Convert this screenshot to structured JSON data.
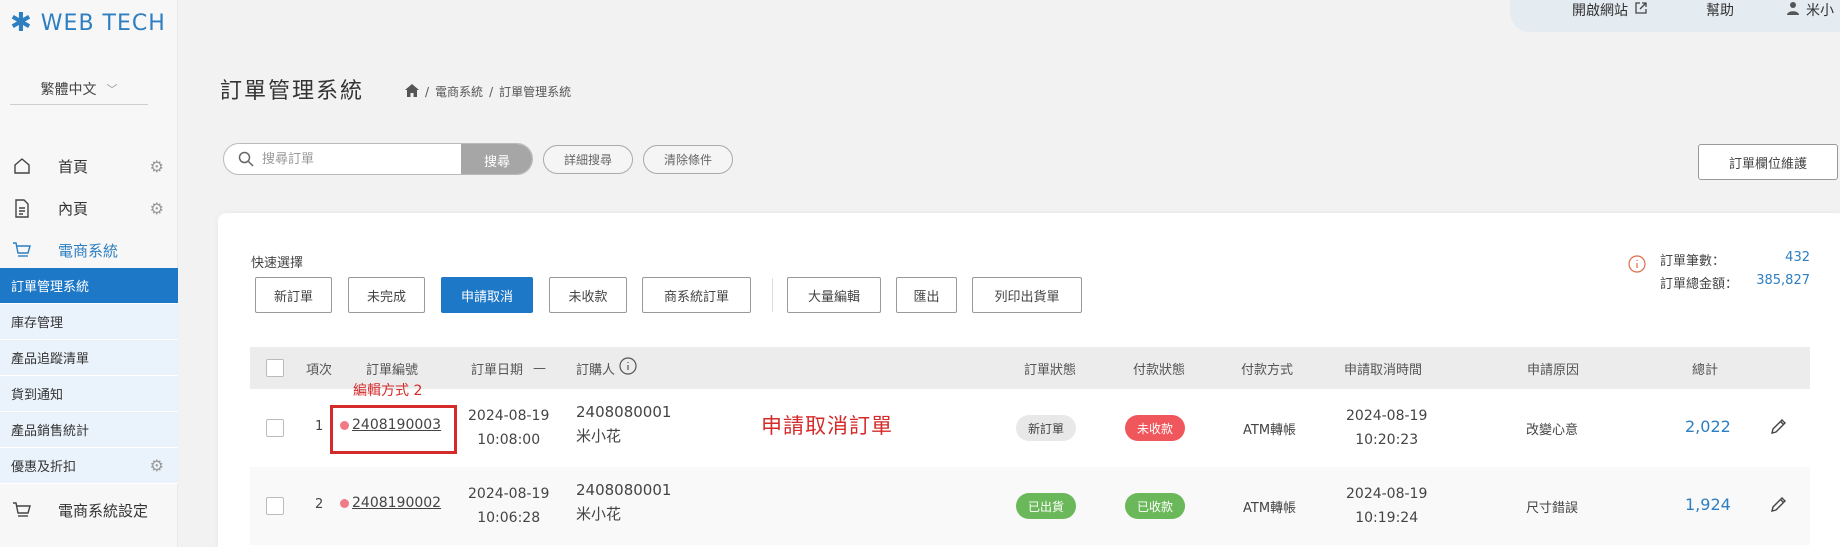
{
  "app": {
    "logo_text": "WEB TECH",
    "accent": "#1e78c8"
  },
  "language": {
    "selected": "繁體中文"
  },
  "sidebar": {
    "top_items": [
      {
        "label": "首頁",
        "icon": "home-icon",
        "gear": true
      },
      {
        "label": "內頁",
        "icon": "page-icon",
        "gear": true
      },
      {
        "label": "電商系統",
        "icon": "cart-icon",
        "gear": false,
        "active": true
      }
    ],
    "sub_items": [
      {
        "label": "訂單管理系統",
        "selected": true
      },
      {
        "label": "庫存管理"
      },
      {
        "label": "產品追蹤清單"
      },
      {
        "label": "貨到通知"
      },
      {
        "label": "產品銷售統計"
      },
      {
        "label": "優惠及折扣",
        "gear": true
      }
    ],
    "bottom_items": [
      {
        "label": "電商系統設定",
        "icon": "cart-icon"
      }
    ]
  },
  "topbar": {
    "open_site": "開啟網站",
    "help": "幫助",
    "user": "米小"
  },
  "page": {
    "title": "訂單管理系統",
    "breadcrumb": [
      "電商系統",
      "訂單管理系統"
    ]
  },
  "search": {
    "placeholder": "搜尋訂單",
    "button": "搜尋",
    "advanced": "詳細搜尋",
    "clear": "清除條件"
  },
  "maintain_button": "訂單欄位維護",
  "quick": {
    "label": "快速選擇",
    "buttons": [
      "新訂單",
      "未完成",
      "申請取消",
      "未收款",
      "商系統訂單"
    ],
    "active": "申請取消",
    "actions": [
      "大量編輯",
      "匯出",
      "列印出貨單"
    ]
  },
  "stats": {
    "count_label": "訂單筆數：",
    "count": "432",
    "total_label": "訂單總金額：",
    "total": "385,827"
  },
  "table": {
    "headers": [
      "項次",
      "訂單編號",
      "訂單日期",
      "訂購人",
      "訂單狀態",
      "付款狀態",
      "付款方式",
      "申請取消時間",
      "申請原因",
      "總計"
    ],
    "rows": [
      {
        "index": "1",
        "order_no": "2408190003",
        "date": "2024-08-19",
        "time": "10:08:00",
        "buyer_id": "2408080001",
        "buyer_name": "米小花",
        "order_status": "新訂單",
        "order_status_color": "gray",
        "pay_status": "未收款",
        "pay_status_color": "red",
        "pay_method": "ATM轉帳",
        "cancel_date": "2024-08-19",
        "cancel_time": "10:20:23",
        "reason": "改變心意",
        "total": "2,022"
      },
      {
        "index": "2",
        "order_no": "2408190002",
        "date": "2024-08-19",
        "time": "10:06:28",
        "buyer_id": "2408080001",
        "buyer_name": "米小花",
        "order_status": "已出貨",
        "order_status_color": "green",
        "pay_status": "已收款",
        "pay_status_color": "green",
        "pay_method": "ATM轉帳",
        "cancel_date": "2024-08-19",
        "cancel_time": "10:19:24",
        "reason": "尺寸錯誤",
        "total": "1,924"
      }
    ]
  },
  "annotations": {
    "edit_method": "編輯方式 2",
    "cancel_order": "申請取消訂單"
  }
}
